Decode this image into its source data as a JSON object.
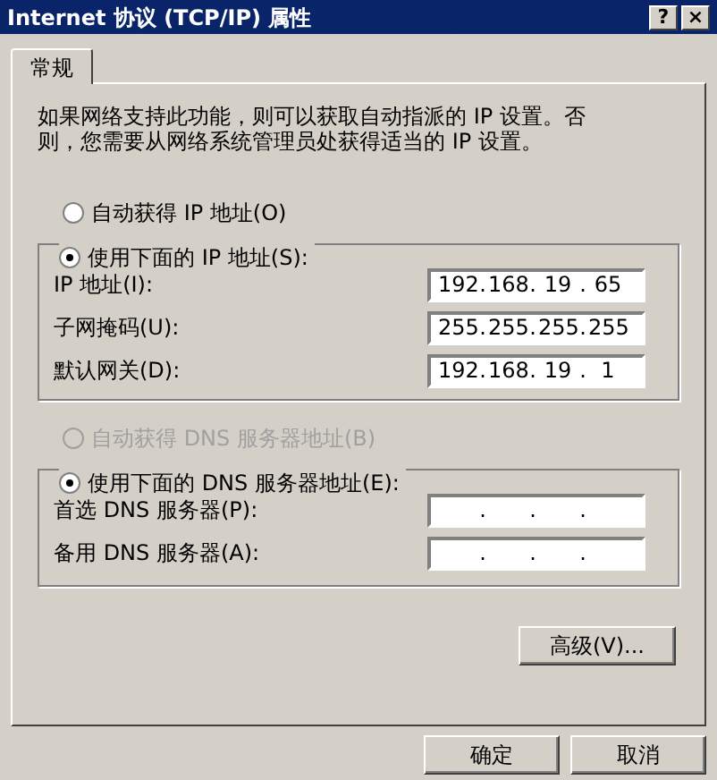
{
  "window": {
    "title": "Internet 协议 (TCP/IP) 属性",
    "buttons": [
      "?",
      "×"
    ]
  },
  "tabs": [
    {
      "label": "常规",
      "selected": true
    }
  ],
  "description": "如果网络支持此功能，则可以获取自动指派的 IP 设置。否则，您需要从网络系统管理员处获得适当的 IP 设置。",
  "separator": ".",
  "ip_mode": [
    {
      "label": "自动获得 IP 地址(O)",
      "selected": false,
      "disabled": false
    },
    {
      "label": "使用下面的 IP 地址(S):",
      "selected": true,
      "disabled": false
    }
  ],
  "ip_fields": [
    {
      "label": "IP 地址(I):",
      "octets": [
        "192",
        "168",
        "19",
        "65"
      ]
    },
    {
      "label": "子网掩码(U):",
      "octets": [
        "255",
        "255",
        "255",
        "255"
      ]
    },
    {
      "label": "默认网关(D):",
      "octets": [
        "192",
        "168",
        "19",
        "1"
      ]
    }
  ],
  "dns_mode": [
    {
      "label": "自动获得 DNS 服务器地址(B)",
      "selected": false,
      "disabled": true
    },
    {
      "label": "使用下面的 DNS 服务器地址(E):",
      "selected": true,
      "disabled": false
    }
  ],
  "dns_fields": [
    {
      "label": "首选 DNS 服务器(P):"
    },
    {
      "label": "备用 DNS 服务器(A):"
    }
  ],
  "advanced_button": "高级(V)...",
  "footer_buttons": [
    "确定",
    "取消"
  ]
}
